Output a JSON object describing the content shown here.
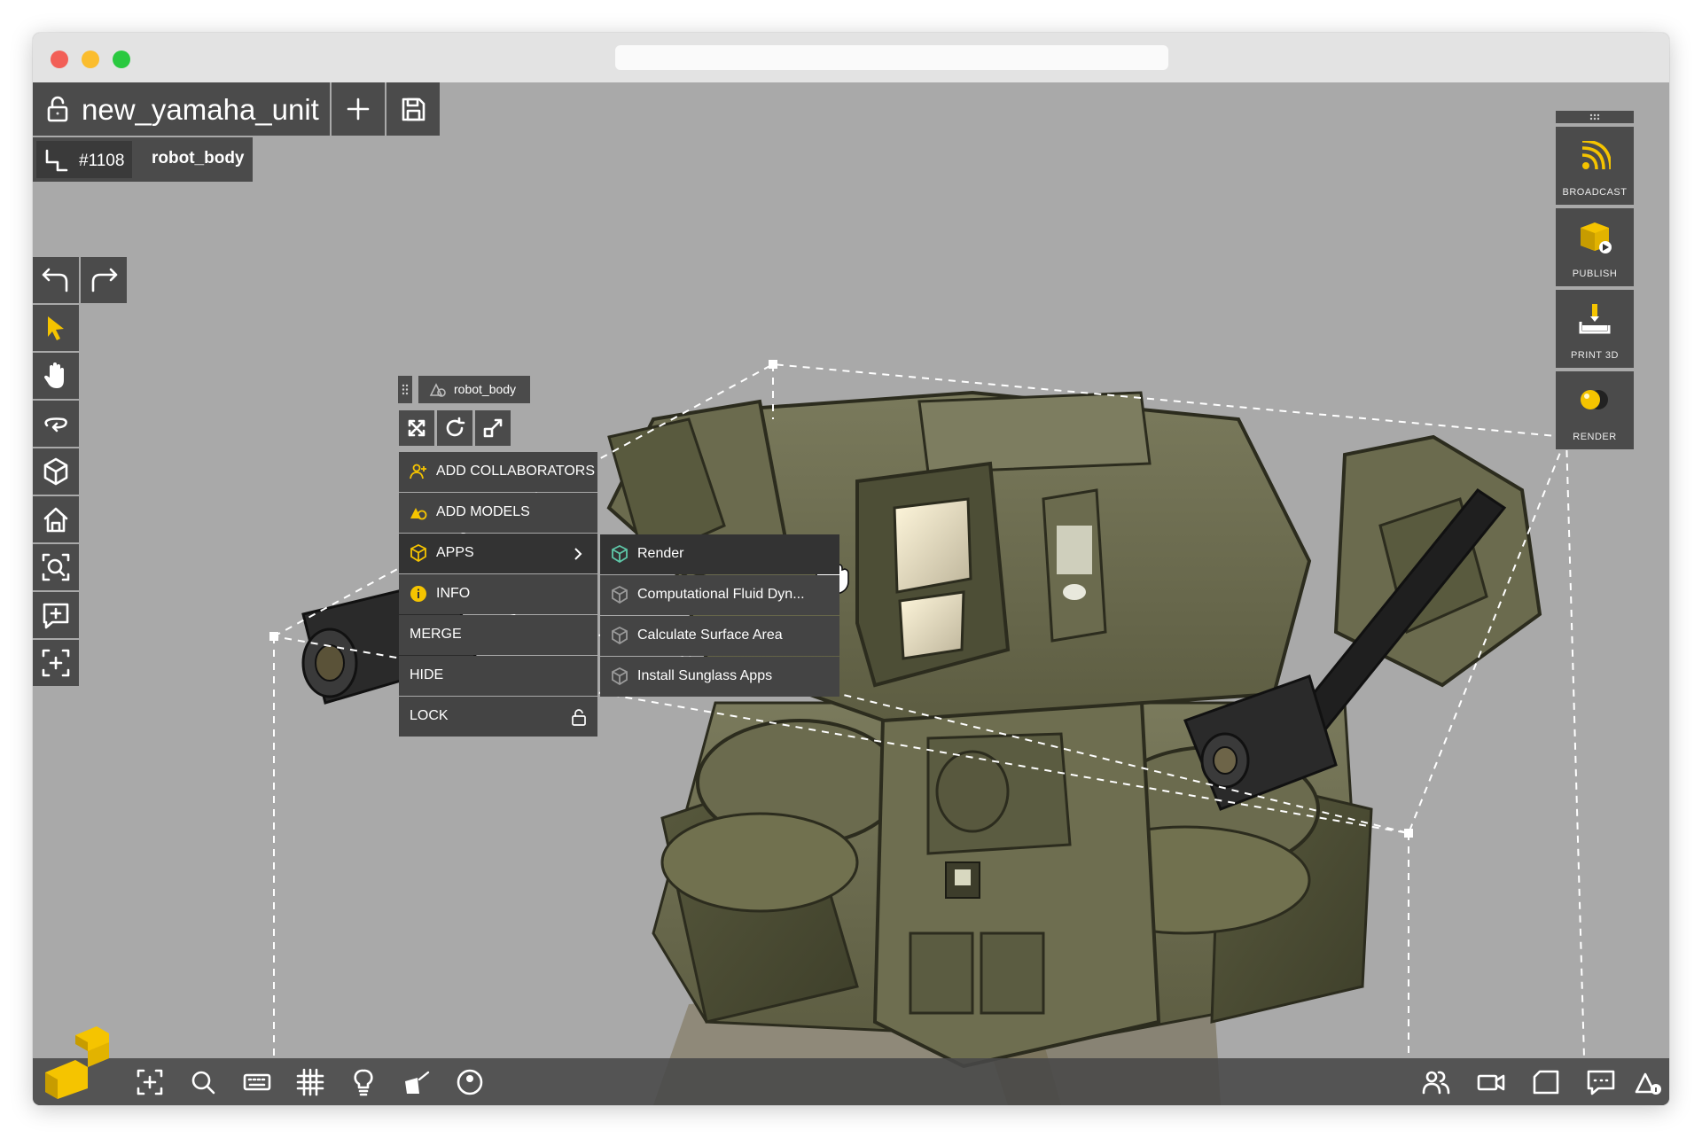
{
  "window": {
    "url": ""
  },
  "project": {
    "title": "new_yamaha_unit"
  },
  "breadcrumb": {
    "id": "#1108",
    "name": "robot_body"
  },
  "object_header": {
    "name": "robot_body"
  },
  "context_menu": {
    "items": [
      {
        "label": "ADD COLLABORATORS",
        "icon": "add-user-icon"
      },
      {
        "label": "ADD MODELS",
        "icon": "shapes-icon"
      },
      {
        "label": "APPS",
        "icon": "cube-icon"
      },
      {
        "label": "INFO",
        "icon": "info-icon"
      },
      {
        "label": "MERGE"
      },
      {
        "label": "HIDE"
      },
      {
        "label": "LOCK",
        "icon": "unlock-icon"
      }
    ]
  },
  "apps_submenu": {
    "items": [
      {
        "label": "Render"
      },
      {
        "label": "Computational Fluid Dyn..."
      },
      {
        "label": "Calculate Surface Area"
      },
      {
        "label": "Install Sunglass Apps"
      }
    ]
  },
  "right_panel": {
    "buttons": [
      {
        "label": "BROADCAST",
        "icon": "broadcast-icon"
      },
      {
        "label": "PUBLISH",
        "icon": "publish-icon"
      },
      {
        "label": "PRINT 3D",
        "icon": "print-3d-icon"
      },
      {
        "label": "RENDER",
        "icon": "render-icon"
      }
    ]
  },
  "colors": {
    "accent": "#f5c400",
    "toolbar": "#4b4b4b",
    "viewport": "#a9a9a9",
    "app_icon": "#5ec7a8"
  }
}
